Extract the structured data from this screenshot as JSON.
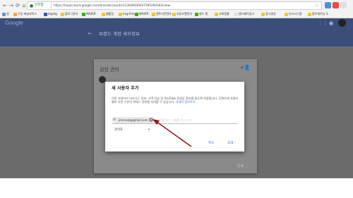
{
  "browser": {
    "nav": {
      "back": "←",
      "forward": "→",
      "reload": "⟳",
      "home": "⌂"
    },
    "secure_label": "안전함",
    "url": "https://myaccount.google.com/brandaccounts/113646639427595269183/view",
    "bookmarks": [
      {
        "label": "앱",
        "color": "#6b8ed6"
      },
      {
        "label": "구글 애널리틱스",
        "color": "#f4a340"
      },
      {
        "label": "bigday",
        "color": "#3f51b5"
      },
      {
        "label": "블로그관리",
        "color": "#f4c430"
      },
      {
        "label": "NAVER",
        "color": "#2db400"
      },
      {
        "label": "웹툴링",
        "color": "#f4c430"
      },
      {
        "label": "img-free",
        "color": "#f4c430"
      },
      {
        "label": "NAVER",
        "color": "#2db400"
      },
      {
        "label": "엔트리콘텐츠",
        "color": "#f4c430"
      },
      {
        "label": "유튜브챌린지",
        "color": "#f4c430"
      },
      {
        "label": "밴드 홈",
        "color": "#2db400"
      },
      {
        "label": "고화질짤",
        "color": "#f4c430"
      },
      {
        "label": "밴드페이광고",
        "color": "#e0e0e0"
      },
      {
        "label": "광고영상",
        "color": "#f4c430"
      },
      {
        "label": "인스타그램",
        "color": "#f4c430"
      },
      {
        "label": "홈트레이닝 3..",
        "color": "#f4c430"
      }
    ]
  },
  "app": {
    "logo": "Google",
    "page_title": "브랜드 계정 세부정보",
    "back_icon": "←"
  },
  "permissions_card": {
    "title": "권한 관리",
    "add_icon": "+👤",
    "done_label": "완료"
  },
  "dialog": {
    "title": "새 사용자 추가",
    "description": "다른 사용자가 비즈니스 정보, 고객 리뷰 및 YouTube 동영상 관리를 돕도록 허용합니다. 간편하게 사용자별로 다른 수준의 액세스 권한을 부여할 수 있습니다.",
    "learn_more": "자세히 알아보기",
    "chip_email": "jiminoel@gmail.com",
    "chip_remove_icon": "×",
    "more_placeholder": "이름 또는 이메일 주소 추가",
    "role": "관리자",
    "cancel_label": "취소",
    "invite_label": "초대"
  },
  "colors": {
    "appbar": "#3b4d79",
    "overlay": "#6b6b6b",
    "link": "#3b6fd8",
    "arrow": "#8b1c1c"
  }
}
